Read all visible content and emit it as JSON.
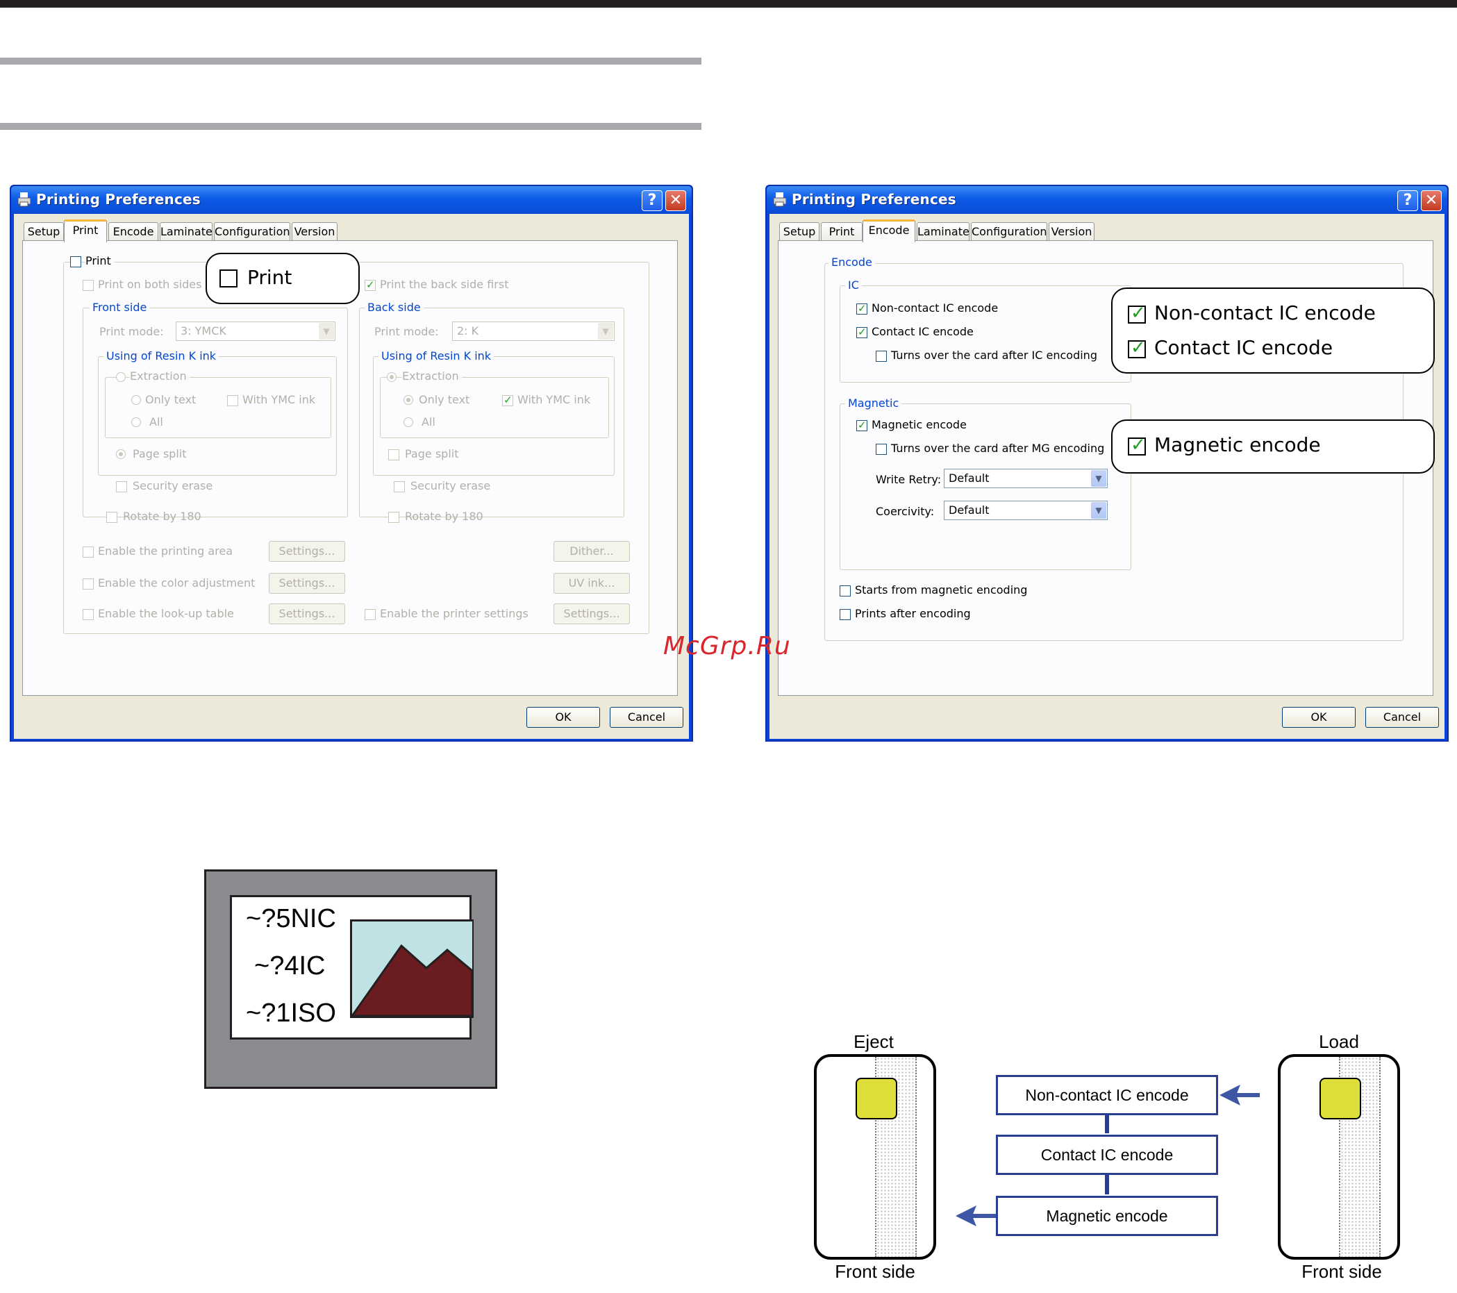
{
  "left_dialog": {
    "title": "Printing Preferences",
    "tabs": [
      "Setup",
      "Print",
      "Encode",
      "Laminate",
      "Configuration",
      "Version"
    ],
    "selected_tab": "Print",
    "print_checkbox": "Print",
    "print_both_sides": "Print on both sides",
    "print_back_first": "Print the back side first",
    "front": {
      "heading": "Front side",
      "print_mode_label": "Print mode:",
      "print_mode_value": "3: YMCK",
      "resin_heading": "Using of Resin K ink",
      "extraction": "Extraction",
      "only_text": "Only text",
      "with_ymc": "With YMC ink",
      "all": "All",
      "page_split": "Page split",
      "security_erase": "Security erase",
      "rotate": "Rotate by 180"
    },
    "back": {
      "heading": "Back side",
      "print_mode_label": "Print mode:",
      "print_mode_value": "2: K",
      "resin_heading": "Using of Resin K ink",
      "extraction": "Extraction",
      "only_text": "Only text",
      "with_ymc": "With YMC ink",
      "all": "All",
      "page_split": "Page split",
      "security_erase": "Security erase",
      "rotate": "Rotate by 180"
    },
    "enable_printing_area": "Enable the printing area",
    "enable_color_adjustment": "Enable the color adjustment",
    "enable_lookup_table": "Enable the look-up table",
    "enable_printer_settings": "Enable the printer settings",
    "settings_label": "Settings...",
    "dither_label": "Dither...",
    "uv_ink_label": "UV ink...",
    "ok": "OK",
    "cancel": "Cancel",
    "callout_print": "Print"
  },
  "right_dialog": {
    "title": "Printing Preferences",
    "tabs": [
      "Setup",
      "Print",
      "Encode",
      "Laminate",
      "Configuration",
      "Version"
    ],
    "selected_tab": "Encode",
    "encode_heading": "Encode",
    "ic_heading": "IC",
    "non_contact": "Non-contact IC encode",
    "contact": "Contact IC encode",
    "turns_ic": "Turns over the card after IC encoding",
    "magnetic_heading": "Magnetic",
    "magnetic_encode": "Magnetic encode",
    "turns_mg": "Turns over the card after MG encoding",
    "write_retry_label": "Write Retry:",
    "write_retry_value": "Default",
    "coercivity_label": "Coercivity:",
    "coercivity_value": "Default",
    "starts_magnetic": "Starts from magnetic encoding",
    "prints_after": "Prints after encoding",
    "ok": "OK",
    "cancel": "Cancel",
    "callout_non_contact": "Non-contact IC encode",
    "callout_contact": "Contact IC encode",
    "callout_magnetic": "Magnetic encode"
  },
  "watermark": "McGrp.Ru",
  "card_sample": {
    "lines": [
      "~?5NIC",
      "~?4IC",
      "~?1ISO"
    ],
    "colors": {
      "frame": "#8a8b8e",
      "sky": "#bfe3e4",
      "mountain": "#6b1c20"
    }
  },
  "flow": {
    "eject_label": "Eject",
    "load_label": "Load",
    "front_side_left": "Front side",
    "front_side_right": "Front side",
    "steps": [
      "Non-contact IC encode",
      "Contact IC encode",
      "Magnetic encode"
    ],
    "colors": {
      "box_border": "#2a3f94",
      "arrow": "#3d56a6",
      "chip": "#dede3a"
    }
  }
}
